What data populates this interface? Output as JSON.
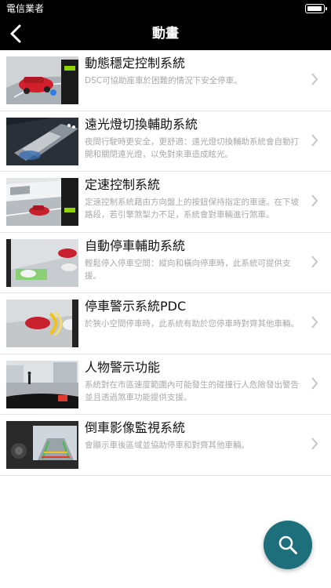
{
  "status_bar": {
    "carrier": "電信業者"
  },
  "nav": {
    "title": "動畫",
    "back_icon": "chevron-left-icon"
  },
  "items": [
    {
      "title": "動態穩定控制系統",
      "desc": "DSC可協助座車於困難的情況下安全停車。"
    },
    {
      "title": "遠光燈切換輔助系統",
      "desc": "夜間行駛時更安全，更舒適：遠光燈切換輔助系統會自動打開和關閉遠光燈，以免對來車造成眩光。"
    },
    {
      "title": "定速控制系統",
      "desc": "定速控制系統藉由方向盤上的按鈕保持指定的車速。在下坡路段，若引擎煞掣力不足，系統會對車輛進行煞車。"
    },
    {
      "title": "自動停車輔助系統",
      "desc": "輕鬆停入停車空間：縱向和橫向停車時，此系統可提供支援。"
    },
    {
      "title": "停車警示系統PDC",
      "desc": "於狹小空間停車時，此系統有助於您停車時對齊其他車輛。"
    },
    {
      "title": "人物警示功能",
      "desc": "系統對在市區速度範圍內可能發生的碰撞行人危險發出警告並且透過煞車功能提供支援。"
    },
    {
      "title": "倒車影像監視系統",
      "desc": "會顯示車後區域並協助停車和對齊其他車輛。"
    }
  ],
  "fab": {
    "icon": "search-icon",
    "color": "#1d6f7b"
  },
  "colors": {
    "bar": "#000000",
    "title": "#111111",
    "desc": "#a9a9a9"
  }
}
